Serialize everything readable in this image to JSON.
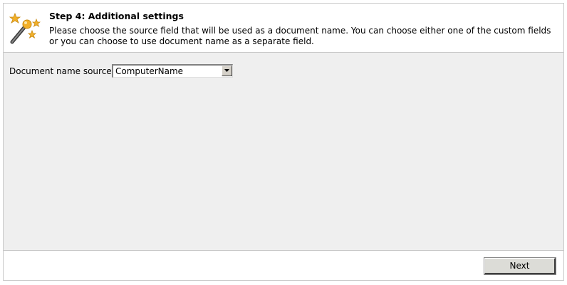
{
  "header": {
    "icon": "magic-wand-icon",
    "title": "Step 4: Additional settings",
    "description": "Please choose the source field that will be used as a document name. You can choose either one of the custom fields or you can choose to use document name as a separate field."
  },
  "form": {
    "document_name_source_label": "Document name source:",
    "document_name_source_value": "ComputerName"
  },
  "footer": {
    "next_label": "Next"
  },
  "colors": {
    "content_background": "#efefef",
    "border": "#c8c8c8",
    "button_face": "#dcdcd7"
  }
}
